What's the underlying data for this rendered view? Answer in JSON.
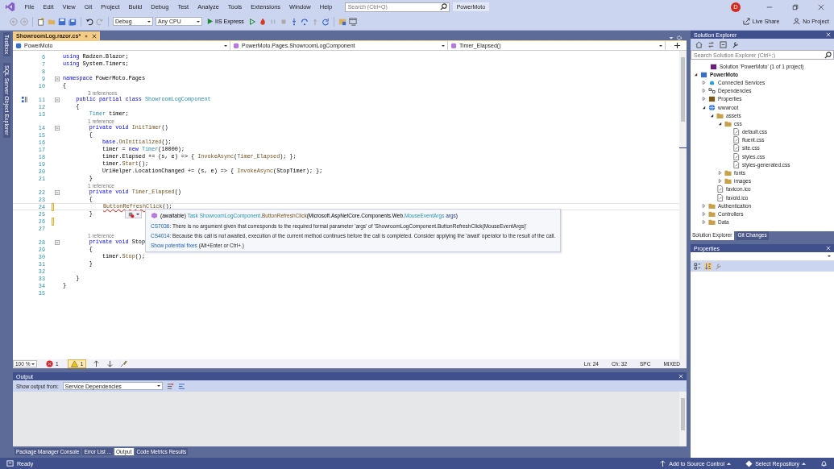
{
  "menu": [
    "File",
    "Edit",
    "View",
    "Git",
    "Project",
    "Build",
    "Debug",
    "Test",
    "Analyze",
    "Tools",
    "Extensions",
    "Window",
    "Help"
  ],
  "search": {
    "placeholder": "Search (Ctrl+Q)"
  },
  "solution_name": "PowerMoto",
  "account_initial": "D",
  "toolbar": {
    "configuration": "Debug",
    "platform": "Any CPU",
    "run_target": "IIS Express"
  },
  "live_share": "Live Share",
  "no_project": "No Project",
  "side_tabs": [
    "Toolbox",
    "SQL Server Object Explorer"
  ],
  "document_tab": {
    "title": "ShowroomLog.razor.cs*",
    "selected": true
  },
  "nav_bar": [
    "PowerMoto",
    "PowerMoto.Pages.ShowroomLogComponent",
    "Timer_Elapsed()"
  ],
  "code_lines": [
    {
      "number": "6",
      "tokens": [
        {
          "text": "using",
          "kind": "kw"
        },
        {
          "text": " Radzen.Blazor;",
          "kind": "plain"
        }
      ]
    },
    {
      "number": "7",
      "tokens": [
        {
          "text": "using",
          "kind": "kw"
        },
        {
          "text": " System.Timers;",
          "kind": "plain"
        }
      ]
    },
    {
      "number": "8"
    },
    {
      "number": "9",
      "collapsible": true,
      "tokens": [
        {
          "text": "namespace",
          "kind": "kw"
        },
        {
          "text": " PowerMoto.Pages",
          "kind": "plain"
        }
      ]
    },
    {
      "number": "10",
      "tokens": [
        {
          "text": "{",
          "kind": "plain"
        }
      ]
    },
    {
      "number": "11",
      "collapsible": true,
      "references": "3 references",
      "tokens": [
        {
          "text": "    public partial class ",
          "kind": "kw"
        },
        {
          "text": "ShowroomLogComponent",
          "kind": "type"
        }
      ]
    },
    {
      "number": "12",
      "tokens": [
        {
          "text": "    {",
          "kind": "plain"
        }
      ]
    },
    {
      "number": "13",
      "tokens": [
        {
          "text": "        Timer",
          "kind": "type"
        },
        {
          "text": " timer;",
          "kind": "plain"
        }
      ]
    },
    {
      "number": "14",
      "collapsible": true,
      "references": "1 reference",
      "tokens": [
        {
          "text": "        private void ",
          "kind": "kw"
        },
        {
          "text": "InitTimer",
          "kind": "method"
        },
        {
          "text": "()",
          "kind": "plain"
        }
      ]
    },
    {
      "number": "15",
      "tokens": [
        {
          "text": "        {",
          "kind": "plain"
        }
      ]
    },
    {
      "number": "16",
      "tokens": [
        {
          "text": "            base",
          "kind": "kw"
        },
        {
          "text": ".",
          "kind": "plain"
        },
        {
          "text": "OnInitialized",
          "kind": "method"
        },
        {
          "text": "();",
          "kind": "plain"
        }
      ]
    },
    {
      "number": "17",
      "tokens": [
        {
          "text": "            timer = ",
          "kind": "plain"
        },
        {
          "text": "new ",
          "kind": "kw"
        },
        {
          "text": "Timer",
          "kind": "type"
        },
        {
          "text": "(10000);",
          "kind": "plain"
        }
      ]
    },
    {
      "number": "18",
      "tokens": [
        {
          "text": "            timer.Elapsed += (s, e) => { ",
          "kind": "plain"
        },
        {
          "text": "InvokeAsync",
          "kind": "method"
        },
        {
          "text": "(",
          "kind": "plain"
        },
        {
          "text": "Timer_Elapsed",
          "kind": "method"
        },
        {
          "text": "); };",
          "kind": "plain"
        }
      ]
    },
    {
      "number": "19",
      "tokens": [
        {
          "text": "            timer.",
          "kind": "plain"
        },
        {
          "text": "Start",
          "kind": "method"
        },
        {
          "text": "();",
          "kind": "plain"
        }
      ]
    },
    {
      "number": "20",
      "tokens": [
        {
          "text": "            UriHelper.LocationChanged += (s, e) => { ",
          "kind": "plain"
        },
        {
          "text": "InvokeAsync",
          "kind": "method"
        },
        {
          "text": "(StopTimer); };",
          "kind": "plain"
        }
      ]
    },
    {
      "number": "21",
      "tokens": [
        {
          "text": "        }",
          "kind": "plain"
        }
      ]
    },
    {
      "number": "22",
      "collapsible": true,
      "references": "1 reference",
      "tokens": [
        {
          "text": "        private void ",
          "kind": "kw"
        },
        {
          "text": "Timer_Elapsed",
          "kind": "method"
        },
        {
          "text": "()",
          "kind": "plain"
        }
      ]
    },
    {
      "number": "23",
      "tokens": [
        {
          "text": "        {",
          "kind": "plain"
        }
      ]
    },
    {
      "number": "24",
      "current": true,
      "changed": true,
      "tokens": [
        {
          "text": "            ButtonRefreshClick",
          "kind": "error"
        },
        {
          "text": "();",
          "kind": "plain"
        }
      ]
    },
    {
      "number": "25",
      "tokens": [
        {
          "text": "        }",
          "kind": "plain"
        }
      ]
    },
    {
      "number": "26",
      "changed": true
    },
    {
      "number": "27"
    },
    {
      "number": "28",
      "collapsible": true,
      "references": "1 reference",
      "tokens": [
        {
          "text": "        private void",
          "kind": "kw"
        },
        {
          "text": " Stop",
          "kind": "plain"
        }
      ]
    },
    {
      "number": "29",
      "tokens": [
        {
          "text": "        {",
          "kind": "plain"
        }
      ]
    },
    {
      "number": "30",
      "tokens": [
        {
          "text": "            timer.",
          "kind": "plain"
        },
        {
          "text": "Stop",
          "kind": "method"
        },
        {
          "text": "();",
          "kind": "plain"
        }
      ]
    },
    {
      "number": "31",
      "tokens": [
        {
          "text": "        }",
          "kind": "plain"
        }
      ]
    },
    {
      "number": "32"
    },
    {
      "number": "33",
      "tokens": [
        {
          "text": "    }",
          "kind": "plain"
        }
      ]
    },
    {
      "number": "34",
      "tokens": [
        {
          "text": "}",
          "kind": "plain"
        }
      ]
    },
    {
      "number": "35"
    }
  ],
  "tooltip": {
    "signature": [
      {
        "text": "(awaitable) ",
        "kind": "plain"
      },
      {
        "text": "Task ShowroomLogComponent",
        "kind": "type"
      },
      {
        "text": ".",
        "kind": "plain"
      },
      {
        "text": "ButtonRefreshClick",
        "kind": "method"
      },
      {
        "text": "(Microsoft.AspNetCore.Components.Web.",
        "kind": "plain"
      },
      {
        "text": "MouseEventArgs",
        "kind": "type"
      },
      {
        "text": " args",
        "kind": "param"
      },
      {
        "text": ")",
        "kind": "plain"
      }
    ],
    "diagnostics": [
      {
        "code": "CS7036",
        "message": ": There is no argument given that corresponds to the required formal parameter 'args' of 'ShowroomLogComponent.ButtonRefreshClick(MouseEventArgs)'"
      },
      {
        "code": "CS4014",
        "message": ": Because this call is not awaited, execution of the current method continues before the call is completed. Consider applying the 'await' operator to the result of the call."
      }
    ],
    "fixes_link": "Show potential fixes",
    "fixes_hint": "(Alt+Enter or Ctrl+.)"
  },
  "editor_status": {
    "zoom": "100 %",
    "errors": "1",
    "warnings": "1",
    "line": "Ln: 24",
    "column": "Ch: 32",
    "whitespace": "SPC",
    "line_endings": "MIXED"
  },
  "output": {
    "title": "Output",
    "source_label": "Show output from:",
    "source": "Service Dependencies",
    "tabs": [
      {
        "label": "Package Manager Console",
        "selected": false
      },
      {
        "label": "Error List ...",
        "selected": false
      },
      {
        "label": "Output",
        "selected": true
      },
      {
        "label": "Code Metrics Results",
        "selected": false
      }
    ]
  },
  "explorer": {
    "title": "Solution Explorer",
    "search_placeholder": "Search Solution Explorer (Ctrl+;)",
    "tree": [
      {
        "label": "Solution 'PowerMoto' (1 of 1 project)",
        "kind": "solution"
      },
      {
        "label": "PowerMoto",
        "kind": "project",
        "expanded": true,
        "children": [
          {
            "label": "Connected Services",
            "kind": "services",
            "expanded": false
          },
          {
            "label": "Dependencies",
            "kind": "dependencies",
            "expanded": false
          },
          {
            "label": "Properties",
            "kind": "properties",
            "expanded": false
          },
          {
            "label": "wwwroot",
            "kind": "globe",
            "expanded": true,
            "children": [
              {
                "label": "assets",
                "kind": "folder",
                "expanded": true,
                "children": [
                  {
                    "label": "css",
                    "kind": "folder",
                    "expanded": true,
                    "children": [
                      {
                        "label": "default.css",
                        "kind": "file"
                      },
                      {
                        "label": "fluent.css",
                        "kind": "file"
                      },
                      {
                        "label": "site.css",
                        "kind": "file"
                      },
                      {
                        "label": "styles.css",
                        "kind": "file"
                      },
                      {
                        "label": "styles-generated.css",
                        "kind": "file"
                      }
                    ]
                  },
                  {
                    "label": "fonts",
                    "kind": "folder",
                    "expanded": false
                  },
                  {
                    "label": "images",
                    "kind": "folder",
                    "expanded": false
                  }
                ]
              },
              {
                "label": "favicon.ico",
                "kind": "file"
              },
              {
                "label": "favold.ico",
                "kind": "file"
              }
            ]
          },
          {
            "label": "Authentication",
            "kind": "folder",
            "expanded": false
          },
          {
            "label": "Controllers",
            "kind": "folder",
            "expanded": false
          },
          {
            "label": "Data",
            "kind": "folder",
            "expanded": false
          }
        ]
      }
    ],
    "tabs": [
      {
        "label": "Solution Explorer",
        "selected": true
      },
      {
        "label": "Git Changes",
        "selected": false
      }
    ]
  },
  "properties": {
    "title": "Properties"
  },
  "status_bar": {
    "state": "Ready",
    "source_control": "Add to Source Control",
    "repository": "Select Repository"
  }
}
